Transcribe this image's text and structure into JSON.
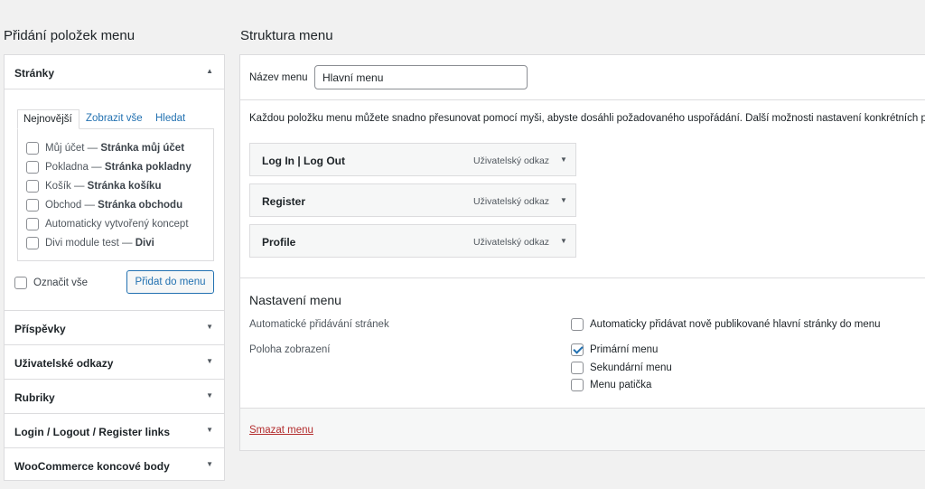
{
  "left": {
    "title": "Přidání položek menu",
    "pages_section": {
      "title": "Stránky",
      "tabs": [
        "Nejnovější",
        "Zobrazit vše",
        "Hledat"
      ],
      "items": [
        {
          "name": "Můj účet",
          "sep": " — ",
          "suffix": "Stránka můj účet"
        },
        {
          "name": "Pokladna",
          "sep": " — ",
          "suffix": "Stránka pokladny"
        },
        {
          "name": "Košík",
          "sep": " — ",
          "suffix": "Stránka košíku"
        },
        {
          "name": "Obchod",
          "sep": " — ",
          "suffix": "Stránka obchodu"
        },
        {
          "name": "Automaticky vytvořený koncept",
          "sep": "",
          "suffix": ""
        },
        {
          "name": "Divi module test",
          "sep": " — ",
          "suffix": "Divi"
        }
      ],
      "select_all": "Označit vše",
      "add_button": "Přidat do menu"
    },
    "sections": [
      "Příspěvky",
      "Uživatelské odkazy",
      "Rubriky",
      "Login / Logout / Register links",
      "WooCommerce koncové body"
    ]
  },
  "right": {
    "title": "Struktura menu",
    "name_label": "Název menu",
    "name_value": "Hlavní menu",
    "instructions": "Každou položku menu můžete snadno přesunovat pomocí myši, abyste dosáhli požadovaného uspořádání. Další možnosti nastavení konkrétních polo",
    "menu_items": [
      {
        "title": "Log In | Log Out",
        "type": "Uživatelský odkaz"
      },
      {
        "title": "Register",
        "type": "Uživatelský odkaz"
      },
      {
        "title": "Profile",
        "type": "Uživatelský odkaz"
      }
    ],
    "settings": {
      "title": "Nastavení menu",
      "auto_add_label": "Automatické přidávání stránek",
      "auto_add_option": "Automaticky přidávat nově publikované hlavní stránky do menu",
      "position_label": "Poloha zobrazení",
      "positions": [
        {
          "label": "Primární menu",
          "checked": true
        },
        {
          "label": "Sekundární menu",
          "checked": false
        },
        {
          "label": "Menu patička",
          "checked": false
        }
      ]
    },
    "delete_link": "Smazat menu"
  },
  "icons": {
    "expanded": "triangle-up-icon",
    "collapsed": "triangle-down-icon",
    "check": "checkmark-icon"
  }
}
